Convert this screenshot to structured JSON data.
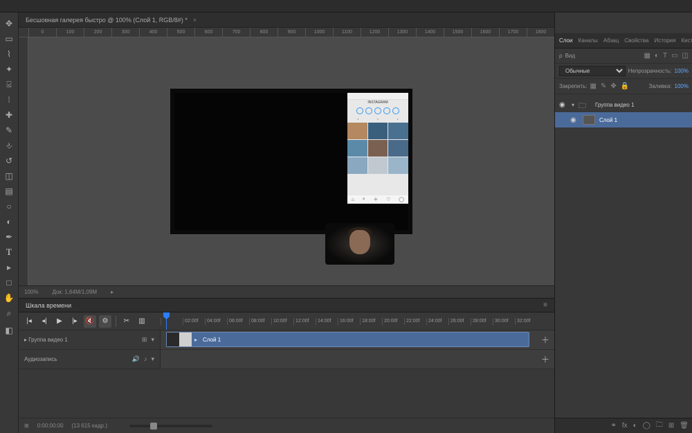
{
  "document": {
    "tab_title": "Бесшовная галерея быстро @ 100% (Слой 1, RGB/8#) *",
    "zoom": "100%",
    "doc_info": "Док: 1,64М/1,09М"
  },
  "ruler_h": [
    "0",
    "100",
    "200",
    "300",
    "400",
    "500",
    "600",
    "700",
    "800",
    "900",
    "1000",
    "1100",
    "1200",
    "1300",
    "1400",
    "1500",
    "1600",
    "1700",
    "1800"
  ],
  "timeline": {
    "title": "Шкала времени",
    "ruler": [
      "",
      "02:00f",
      "04:00f",
      "06:00f",
      "08:00f",
      "10:00f",
      "12:00f",
      "14:00f",
      "16:00f",
      "18:00f",
      "20:00f",
      "22:00f",
      "24:00f",
      "26:00f",
      "28:00f",
      "30:00f",
      "32:00f"
    ],
    "track_video": "Группа видео 1",
    "track_audio": "Аудиозапись",
    "clip_label": "Слой 1",
    "time": "0:00:00:00",
    "frames": "(13 615 кадр.)"
  },
  "panels": {
    "tabs": [
      "Слои",
      "Каналы",
      "Абзац",
      "Свойства",
      "История",
      "Кисть"
    ],
    "kind_label": "Вид",
    "blend": "Обычные",
    "opacity_label": "Непрозрачность:",
    "opacity": "100%",
    "lock_label": "Закрепить:",
    "fill_label": "Заливка:",
    "fill": "100%"
  },
  "layers": {
    "group": "Группа видео 1",
    "layer1": "Слой 1"
  },
  "phone": {
    "title": "INSTAGRAM"
  }
}
